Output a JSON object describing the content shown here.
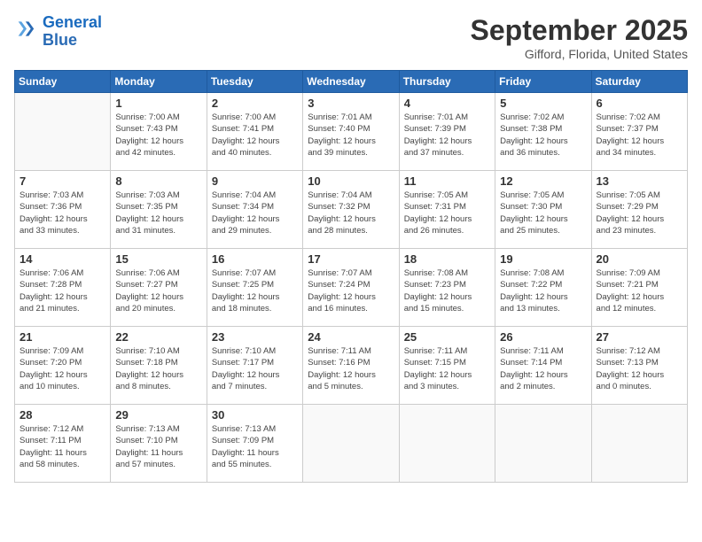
{
  "header": {
    "logo_line1": "General",
    "logo_line2": "Blue",
    "month_title": "September 2025",
    "location": "Gifford, Florida, United States"
  },
  "weekdays": [
    "Sunday",
    "Monday",
    "Tuesday",
    "Wednesday",
    "Thursday",
    "Friday",
    "Saturday"
  ],
  "weeks": [
    [
      {
        "day": null,
        "info": null
      },
      {
        "day": "1",
        "info": "Sunrise: 7:00 AM\nSunset: 7:43 PM\nDaylight: 12 hours\nand 42 minutes."
      },
      {
        "day": "2",
        "info": "Sunrise: 7:00 AM\nSunset: 7:41 PM\nDaylight: 12 hours\nand 40 minutes."
      },
      {
        "day": "3",
        "info": "Sunrise: 7:01 AM\nSunset: 7:40 PM\nDaylight: 12 hours\nand 39 minutes."
      },
      {
        "day": "4",
        "info": "Sunrise: 7:01 AM\nSunset: 7:39 PM\nDaylight: 12 hours\nand 37 minutes."
      },
      {
        "day": "5",
        "info": "Sunrise: 7:02 AM\nSunset: 7:38 PM\nDaylight: 12 hours\nand 36 minutes."
      },
      {
        "day": "6",
        "info": "Sunrise: 7:02 AM\nSunset: 7:37 PM\nDaylight: 12 hours\nand 34 minutes."
      }
    ],
    [
      {
        "day": "7",
        "info": "Sunrise: 7:03 AM\nSunset: 7:36 PM\nDaylight: 12 hours\nand 33 minutes."
      },
      {
        "day": "8",
        "info": "Sunrise: 7:03 AM\nSunset: 7:35 PM\nDaylight: 12 hours\nand 31 minutes."
      },
      {
        "day": "9",
        "info": "Sunrise: 7:04 AM\nSunset: 7:34 PM\nDaylight: 12 hours\nand 29 minutes."
      },
      {
        "day": "10",
        "info": "Sunrise: 7:04 AM\nSunset: 7:32 PM\nDaylight: 12 hours\nand 28 minutes."
      },
      {
        "day": "11",
        "info": "Sunrise: 7:05 AM\nSunset: 7:31 PM\nDaylight: 12 hours\nand 26 minutes."
      },
      {
        "day": "12",
        "info": "Sunrise: 7:05 AM\nSunset: 7:30 PM\nDaylight: 12 hours\nand 25 minutes."
      },
      {
        "day": "13",
        "info": "Sunrise: 7:05 AM\nSunset: 7:29 PM\nDaylight: 12 hours\nand 23 minutes."
      }
    ],
    [
      {
        "day": "14",
        "info": "Sunrise: 7:06 AM\nSunset: 7:28 PM\nDaylight: 12 hours\nand 21 minutes."
      },
      {
        "day": "15",
        "info": "Sunrise: 7:06 AM\nSunset: 7:27 PM\nDaylight: 12 hours\nand 20 minutes."
      },
      {
        "day": "16",
        "info": "Sunrise: 7:07 AM\nSunset: 7:25 PM\nDaylight: 12 hours\nand 18 minutes."
      },
      {
        "day": "17",
        "info": "Sunrise: 7:07 AM\nSunset: 7:24 PM\nDaylight: 12 hours\nand 16 minutes."
      },
      {
        "day": "18",
        "info": "Sunrise: 7:08 AM\nSunset: 7:23 PM\nDaylight: 12 hours\nand 15 minutes."
      },
      {
        "day": "19",
        "info": "Sunrise: 7:08 AM\nSunset: 7:22 PM\nDaylight: 12 hours\nand 13 minutes."
      },
      {
        "day": "20",
        "info": "Sunrise: 7:09 AM\nSunset: 7:21 PM\nDaylight: 12 hours\nand 12 minutes."
      }
    ],
    [
      {
        "day": "21",
        "info": "Sunrise: 7:09 AM\nSunset: 7:20 PM\nDaylight: 12 hours\nand 10 minutes."
      },
      {
        "day": "22",
        "info": "Sunrise: 7:10 AM\nSunset: 7:18 PM\nDaylight: 12 hours\nand 8 minutes."
      },
      {
        "day": "23",
        "info": "Sunrise: 7:10 AM\nSunset: 7:17 PM\nDaylight: 12 hours\nand 7 minutes."
      },
      {
        "day": "24",
        "info": "Sunrise: 7:11 AM\nSunset: 7:16 PM\nDaylight: 12 hours\nand 5 minutes."
      },
      {
        "day": "25",
        "info": "Sunrise: 7:11 AM\nSunset: 7:15 PM\nDaylight: 12 hours\nand 3 minutes."
      },
      {
        "day": "26",
        "info": "Sunrise: 7:11 AM\nSunset: 7:14 PM\nDaylight: 12 hours\nand 2 minutes."
      },
      {
        "day": "27",
        "info": "Sunrise: 7:12 AM\nSunset: 7:13 PM\nDaylight: 12 hours\nand 0 minutes."
      }
    ],
    [
      {
        "day": "28",
        "info": "Sunrise: 7:12 AM\nSunset: 7:11 PM\nDaylight: 11 hours\nand 58 minutes."
      },
      {
        "day": "29",
        "info": "Sunrise: 7:13 AM\nSunset: 7:10 PM\nDaylight: 11 hours\nand 57 minutes."
      },
      {
        "day": "30",
        "info": "Sunrise: 7:13 AM\nSunset: 7:09 PM\nDaylight: 11 hours\nand 55 minutes."
      },
      {
        "day": null,
        "info": null
      },
      {
        "day": null,
        "info": null
      },
      {
        "day": null,
        "info": null
      },
      {
        "day": null,
        "info": null
      }
    ]
  ]
}
